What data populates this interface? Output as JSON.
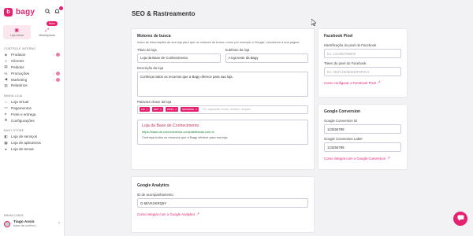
{
  "brand": {
    "name": "bagy",
    "accent": "#e5206f"
  },
  "header": {
    "search_icon": "search-icon",
    "bell_icon": "bell-icon"
  },
  "tiles": [
    {
      "label": "Loja virtual",
      "active": true
    },
    {
      "label": "Marketplaces",
      "badge": "Novo"
    }
  ],
  "sidebar": {
    "section_control": "Controle interno",
    "control_items": [
      {
        "label": "Produtos",
        "icon": "tag-icon",
        "dot": true
      },
      {
        "label": "Clientes",
        "icon": "users-icon"
      },
      {
        "label": "Pedidos",
        "icon": "cart-icon"
      },
      {
        "label": "Promoções",
        "icon": "percent-icon",
        "dot": true
      },
      {
        "label": "Marketing",
        "icon": "megaphone-icon",
        "dot": true
      },
      {
        "label": "Relatórios",
        "icon": "chart-icon"
      }
    ],
    "section_store": "Minha loja",
    "store_items": [
      {
        "label": "Loja virtual",
        "icon": "store-icon"
      },
      {
        "label": "Pagamentos",
        "icon": "card-icon"
      },
      {
        "label": "Frete e entrega",
        "icon": "truck-icon"
      },
      {
        "label": "Configurações",
        "icon": "gear-icon"
      }
    ],
    "section_bagy_store": "Bagy Store",
    "bagy_store_items": [
      {
        "label": "Loja de serviços",
        "icon": "bag-icon"
      },
      {
        "label": "Loja de aplicativos",
        "icon": "apps-icon"
      },
      {
        "label": "Loja de temas",
        "icon": "palette-icon"
      }
    ],
    "account_title": "Minha conta",
    "account_name": "Tiago Assis",
    "account_sub": "base-de-conheci..."
  },
  "page": {
    "title": "SEO & Rastreamento"
  },
  "search_engines": {
    "title": "Motores de busca",
    "description": "Insira as informações da sua loja para que os motores de busca, como por exemplo o Google, encontrem a sua página",
    "store_title_label": "Título da loja",
    "store_title_value": "Loja da Base de Conhecimento",
    "store_subtitle_label": "Subtítulo da loja",
    "store_subtitle_value": "A loja teste da Bagy",
    "description_label": "Descrição da loja",
    "description_value": "Conheça todos os recursos que a Bagy oferece para sua loja.",
    "keywords_label": "Palavras chave da loja",
    "keywords": [
      "cor",
      "azul",
      "cores",
      "tamanhos"
    ],
    "keywords_placeholder": "Ex: capacete moda, vestido, roupas",
    "preview_title": "Loja da Base de Conhecimento",
    "preview_url": "https://base-de-conhecimento.comprafeitanas.com.br",
    "preview_desc": "Conheça todos os recursos que a Bagy oferece para sua loja."
  },
  "google_analytics": {
    "title": "Google Analytics",
    "tracking_label": "ID de acompanhamento",
    "tracking_value": "G-6EVKXKRQ6Y",
    "link": "Como integrar com o Google Analytics"
  },
  "facebook_pixel": {
    "title": "Facebook Pixel",
    "pixel_id_label": "Identificação do pixel do Facebook",
    "pixel_id_placeholder": "Ex: 123456789000",
    "pixel_token_label": "Token do pixel do Facebook",
    "pixel_token_placeholder": "Ex: 0D2V1W2E5D6F0F0V4",
    "link": "Como configurar o Facebook Pixel"
  },
  "google_conversion": {
    "title": "Google Conversion",
    "id_label": "Google Conversion ID",
    "id_value": "123456789",
    "conv_label_label": "Google Conversion Label",
    "conv_label_value": "123456789",
    "link": "Como integrar com o Google Conversion"
  }
}
